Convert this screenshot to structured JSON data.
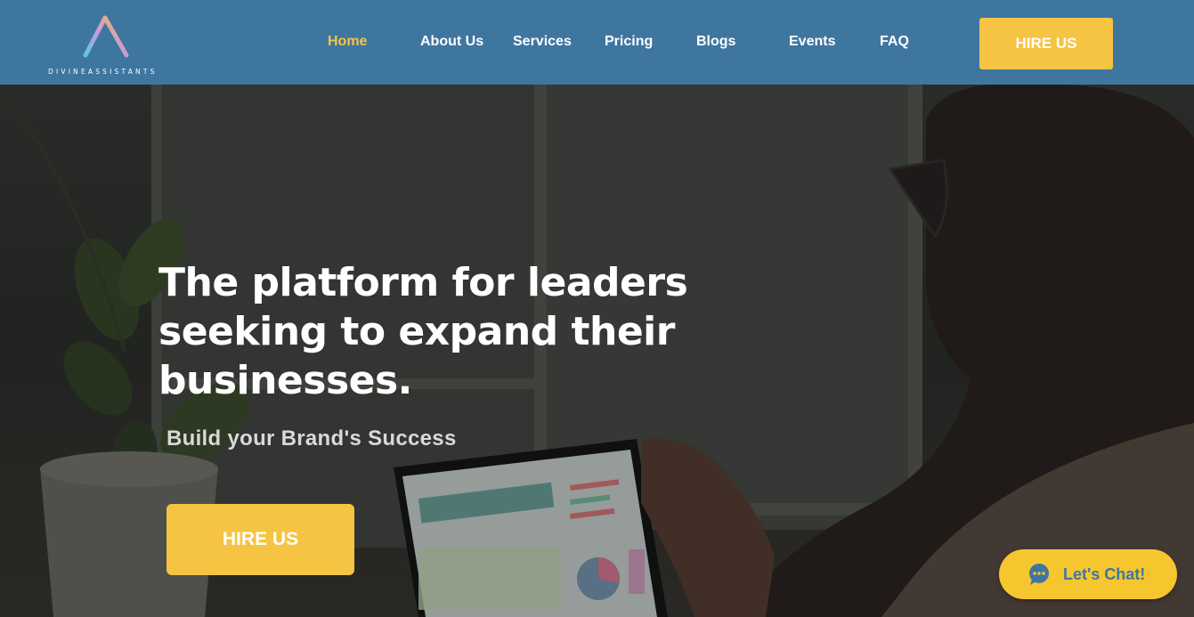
{
  "brand": {
    "logo_text": "DIVINEASSISTANTS"
  },
  "nav": {
    "items": [
      {
        "label": "Home",
        "active": true
      },
      {
        "label": "About Us",
        "active": false
      },
      {
        "label": "Services",
        "active": false
      },
      {
        "label": "Pricing",
        "active": false
      },
      {
        "label": "Blogs",
        "active": false
      },
      {
        "label": "Events",
        "active": false
      },
      {
        "label": "FAQ",
        "active": false
      }
    ],
    "cta_label": "HIRE US"
  },
  "hero": {
    "title": "The platform for leaders seeking to expand their businesses.",
    "subtitle": "Build your Brand's Success",
    "cta_label": "HIRE US"
  },
  "chat": {
    "label": "Let's Chat!",
    "icon": "chat-bubble-icon"
  },
  "colors": {
    "header_bg": "#3f76a0",
    "accent": "#f6c443",
    "chat_text": "#3f76a0"
  }
}
